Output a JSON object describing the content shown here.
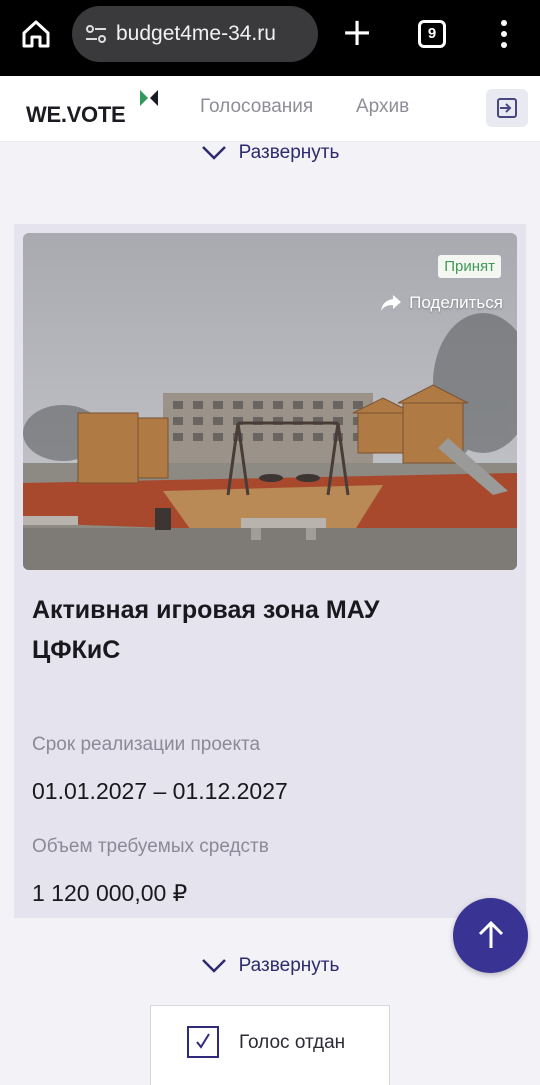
{
  "browser": {
    "url": "budget4me-34.ru",
    "tab_count": "9"
  },
  "site": {
    "logo": "WE.VOTE",
    "nav": [
      "Голосования",
      "Архив"
    ]
  },
  "expand_label": "Развернуть",
  "project": {
    "status": "Принят",
    "share_label": "Поделиться",
    "title": "Активная игровая зона МАУ ЦФКиС",
    "term_label": "Срок реализации проекта",
    "term_value": "01.01.2027 – 01.12.2027",
    "funds_label": "Объем требуемых средств",
    "funds_value": "1 120 000,00 ₽"
  },
  "vote": {
    "label": "Голос отдан"
  },
  "colors": {
    "accent": "#393494",
    "status_green": "#3f9b56",
    "card_bg": "#e4e3ee"
  }
}
